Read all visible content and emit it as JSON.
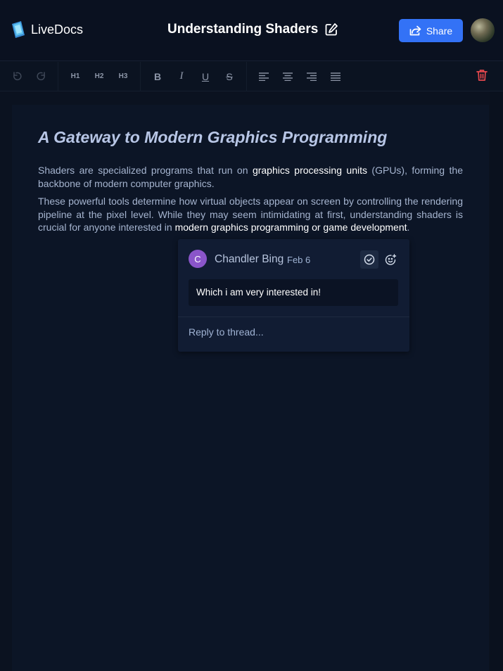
{
  "header": {
    "app_name": "LiveDocs",
    "document_title": "Understanding Shaders",
    "share_label": "Share"
  },
  "toolbar": {
    "undo": "undo",
    "redo": "redo",
    "h1": "H1",
    "h2": "H2",
    "h3": "H3",
    "bold": "B",
    "italic": "I",
    "underline": "U",
    "strike": "S"
  },
  "document": {
    "heading": "A Gateway to Modern Graphics Programming",
    "p1_a": "Shaders are specialized programs that run on ",
    "p1_hl": "graphics processing units",
    "p1_b": " (GPUs), forming the backbone of modern computer graphics.",
    "p2_a": "These powerful tools determine how virtual objects appear on screen by controlling the rendering pipeline at the pixel level. While they may seem intimidating at first, understanding shaders is crucial for anyone interested in ",
    "p2_hl": "modern graphics programming or game development",
    "p2_b": "."
  },
  "thread": {
    "avatar_initial": "C",
    "author": "Chandler Bing",
    "date": "Feb 6",
    "comment": "Which i am very interested in!",
    "reply_placeholder": "Reply to thread..."
  },
  "colors": {
    "accent": "#3372f6",
    "avatar_purple": "#8a55c9",
    "danger": "#e5484d",
    "background": "#0b1220"
  }
}
